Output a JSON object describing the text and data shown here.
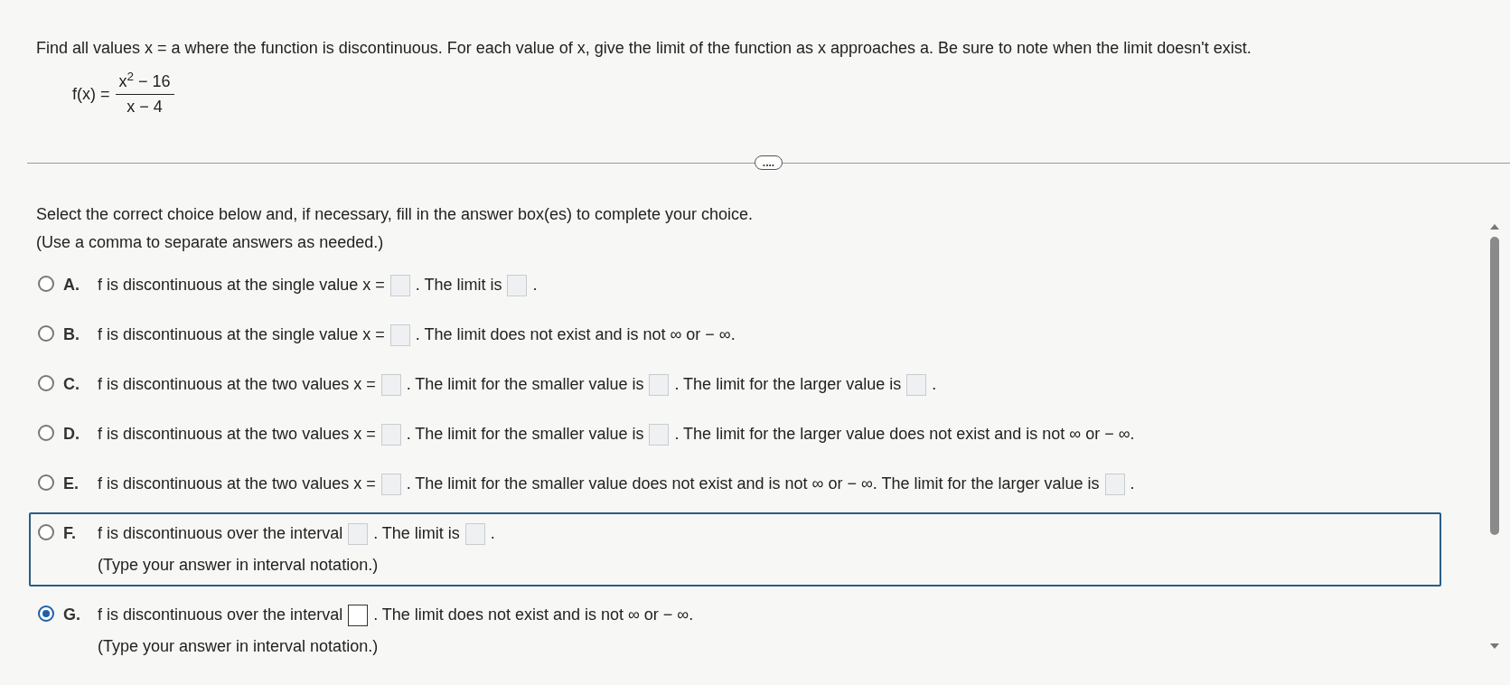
{
  "question": "Find all values x = a where the function is discontinuous. For each value of x, give the limit of the function as x approaches a. Be sure to note when the limit doesn't exist.",
  "function": {
    "lhs": "f(x) =",
    "numerator": "x$^{2}$ − 16",
    "denominator": "x − 4"
  },
  "divider_button": "....",
  "instructions": [
    "Select the correct choice below and, if necessary, fill in the answer box(es) to complete your choice.",
    "(Use a comma to separate answers as needed.)"
  ],
  "choices": [
    {
      "letter": "A.",
      "selected": false,
      "focused": false,
      "parts": [
        {
          "kind": "text",
          "text": "f is discontinuous at the single value x ="
        },
        {
          "kind": "box"
        },
        {
          "kind": "text",
          "text": ". The limit is"
        },
        {
          "kind": "box"
        },
        {
          "kind": "text",
          "text": "."
        }
      ]
    },
    {
      "letter": "B.",
      "selected": false,
      "focused": false,
      "parts": [
        {
          "kind": "text",
          "text": "f is discontinuous at the single value x ="
        },
        {
          "kind": "box"
        },
        {
          "kind": "text",
          "text": ". The limit does not exist and is not ∞ or − ∞."
        }
      ]
    },
    {
      "letter": "C.",
      "selected": false,
      "focused": false,
      "parts": [
        {
          "kind": "text",
          "text": "f is discontinuous at the two values x ="
        },
        {
          "kind": "box"
        },
        {
          "kind": "text",
          "text": ". The limit for the smaller value is"
        },
        {
          "kind": "box"
        },
        {
          "kind": "text",
          "text": ". The limit for the larger value is"
        },
        {
          "kind": "box"
        },
        {
          "kind": "text",
          "text": "."
        }
      ]
    },
    {
      "letter": "D.",
      "selected": false,
      "focused": false,
      "parts": [
        {
          "kind": "text",
          "text": "f is discontinuous at the two values x ="
        },
        {
          "kind": "box"
        },
        {
          "kind": "text",
          "text": ". The limit for the smaller value is"
        },
        {
          "kind": "box"
        },
        {
          "kind": "text",
          "text": ". The limit for the larger value does not exist and is not ∞ or − ∞."
        }
      ]
    },
    {
      "letter": "E.",
      "selected": false,
      "focused": false,
      "parts": [
        {
          "kind": "text",
          "text": "f is discontinuous at the two values x ="
        },
        {
          "kind": "box"
        },
        {
          "kind": "text",
          "text": ". The limit for the smaller value does not exist and is not ∞ or − ∞. The limit for the larger value is"
        },
        {
          "kind": "box"
        },
        {
          "kind": "text",
          "text": "."
        }
      ]
    },
    {
      "letter": "F.",
      "selected": false,
      "focused": true,
      "parts": [
        {
          "kind": "text",
          "text": "f is discontinuous over the interval"
        },
        {
          "kind": "box"
        },
        {
          "kind": "text",
          "text": ". The limit is"
        },
        {
          "kind": "box"
        },
        {
          "kind": "text",
          "text": "."
        }
      ],
      "note": "(Type your answer in interval notation.)"
    },
    {
      "letter": "G.",
      "selected": true,
      "focused": false,
      "parts": [
        {
          "kind": "text",
          "text": "f is discontinuous over the interval"
        },
        {
          "kind": "box"
        },
        {
          "kind": "text",
          "text": ". The limit does not exist and is not ∞ or − ∞."
        }
      ],
      "note": "(Type your answer in interval notation.)"
    }
  ]
}
